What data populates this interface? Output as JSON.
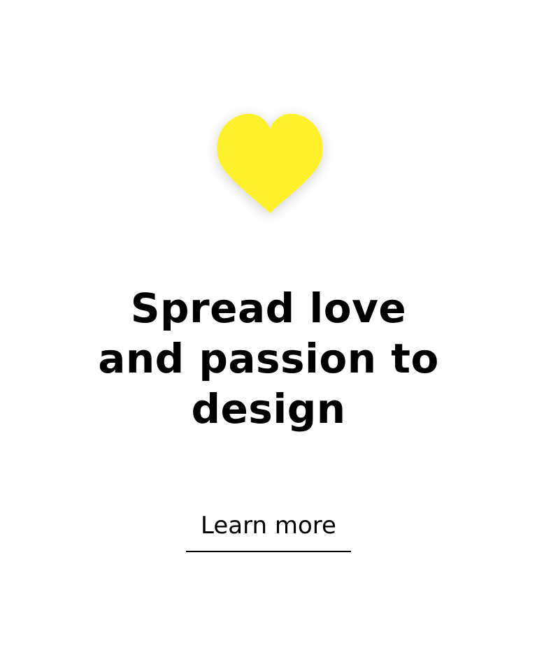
{
  "hero": {
    "icon": "heart-icon",
    "icon_color": "#FFF02A",
    "headline_lines": [
      "Spread love",
      "and passion to",
      "design"
    ]
  },
  "cta": {
    "label": "Learn more"
  }
}
